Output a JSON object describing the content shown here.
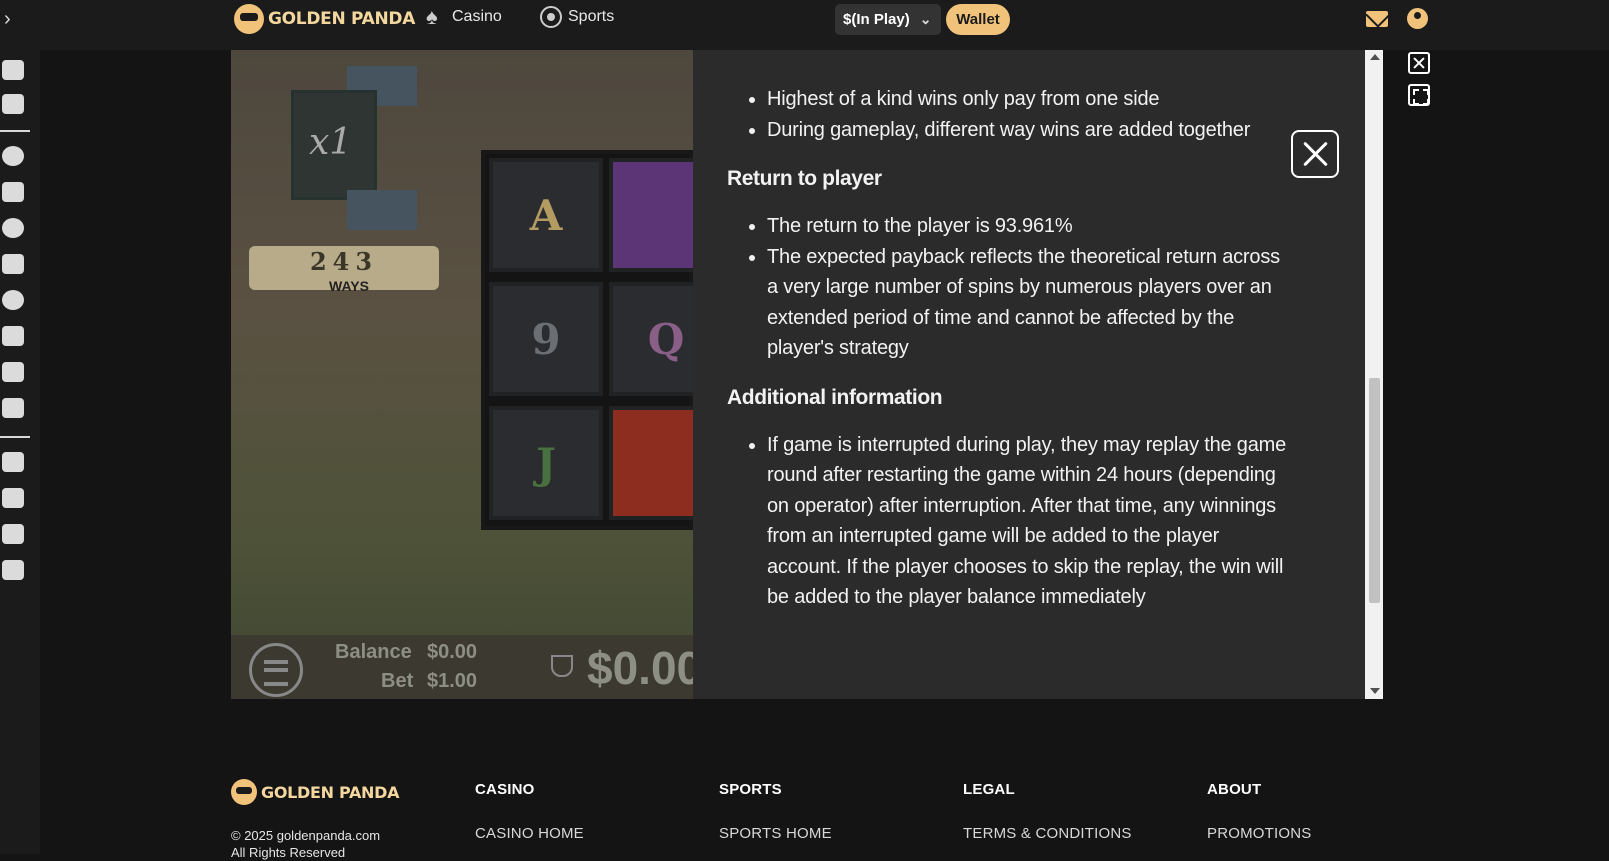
{
  "header": {
    "brand": "GOLDEN PANDA",
    "nav": [
      {
        "label": "Casino"
      },
      {
        "label": "Sports"
      }
    ],
    "balance_label": "$(In Play)",
    "wallet_label": "Wallet",
    "icons": {
      "mail": "mail-icon",
      "profile": "user-icon"
    }
  },
  "game": {
    "multiplier": "x1",
    "ways_number": "243",
    "ways_label": "WAYS",
    "reel_symbols": [
      "A",
      "9",
      "J",
      "Q"
    ],
    "balance_label": "Balance",
    "balance_value": "$0.00",
    "bet_label": "Bet",
    "bet_value": "$1.00",
    "win_value": "$0.00"
  },
  "rules": {
    "bullets_top": [
      "Highest of a kind wins only pay from one side",
      "During gameplay, different way wins are added together"
    ],
    "rtp_heading": "Return to player",
    "rtp_bullets": [
      "The return to the player is 93.961%",
      "The expected payback reflects the theoretical return across a very large number of spins by numerous players over an extended period of time and cannot be affected by the player's strategy"
    ],
    "additional_heading": "Additional information",
    "additional_bullets": [
      "If game is interrupted during play, they may replay the game round after restarting the game within 24 hours (depending on operator) after interruption. After that time, any winnings from an interrupted game will be added to the player account. If the player chooses to skip the replay, the win will be added to the player balance immediately"
    ]
  },
  "footer": {
    "brand": "GOLDEN PANDA",
    "copyright_line1": "© 2025 goldenpanda.com",
    "copyright_line2": "All Rights Reserved",
    "columns": [
      {
        "heading": "CASINO",
        "link": "CASINO HOME"
      },
      {
        "heading": "SPORTS",
        "link": "SPORTS HOME"
      },
      {
        "heading": "LEGAL",
        "link": "TERMS & CONDITIONS"
      },
      {
        "heading": "ABOUT",
        "link": "PROMOTIONS"
      }
    ]
  },
  "colors": {
    "accent": "#f1c27a",
    "background": "#141414",
    "panel": "#2b2b2b"
  }
}
